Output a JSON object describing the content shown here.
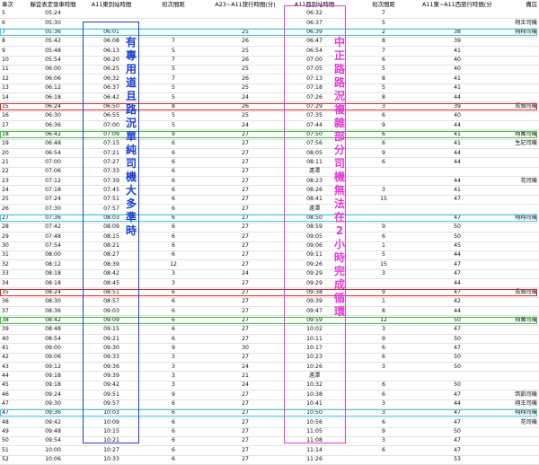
{
  "headers": [
    "車次",
    "靜宜表定發車時間",
    "A11東到站時間",
    "班次間距",
    "A23~A11旅行時間(分)",
    "A11西到站時間",
    "班次間距",
    "A11東~A11西旅行時間(分)",
    "備註"
  ],
  "rows": [
    [
      "5",
      "05:24",
      "",
      "",
      "",
      "06:32",
      "7",
      ""
    ],
    [
      "6",
      "05:30",
      "",
      "",
      "",
      "06:37",
      "5",
      "",
      "翔王司機"
    ],
    [
      "7",
      "05:36",
      "06:01",
      "",
      "25",
      "06:39",
      "2",
      "38",
      "翔翔司機"
    ],
    [
      "8",
      "05:42",
      "06:08",
      "7",
      "26",
      "06:47",
      "8",
      "39",
      ""
    ],
    [
      "9",
      "05:48",
      "06:13",
      "5",
      "25",
      "06:54",
      "7",
      "41",
      ""
    ],
    [
      "10",
      "05:54",
      "06:20",
      "7",
      "26",
      "07:00",
      "6",
      "40",
      ""
    ],
    [
      "11",
      "06:00",
      "06:25",
      "5",
      "25",
      "07:05",
      "5",
      "40",
      ""
    ],
    [
      "12",
      "06:06",
      "06:32",
      "7",
      "26",
      "07:13",
      "8",
      "41",
      ""
    ],
    [
      "13",
      "06:12",
      "06:37",
      "5",
      "25",
      "07:18",
      "5",
      "41",
      ""
    ],
    [
      "14",
      "06:18",
      "06:42",
      "5",
      "24",
      "07:26",
      "8",
      "44",
      ""
    ],
    [
      "15",
      "06:24",
      "06:50",
      "8",
      "26",
      "07:29",
      "3",
      "39",
      "長頭司機"
    ],
    [
      "16",
      "06:30",
      "06:55",
      "5",
      "25",
      "07:35",
      "6",
      "40",
      ""
    ],
    [
      "17",
      "06:36",
      "07:00",
      "5",
      "24",
      "07:44",
      "9",
      "44",
      ""
    ],
    [
      "18",
      "06:42",
      "07:09",
      "9",
      "27",
      "07:50",
      "6",
      "41",
      "翔萬司機"
    ],
    [
      "19",
      "06:48",
      "07:15",
      "6",
      "27",
      "07:56",
      "6",
      "41",
      "生記司機"
    ],
    [
      "20",
      "06:54",
      "07:21",
      "6",
      "27",
      "08:05",
      "9",
      "44",
      ""
    ],
    [
      "21",
      "07:00",
      "07:27",
      "6",
      "27",
      "08:11",
      "6",
      "44",
      ""
    ],
    [
      "22",
      "07:06",
      "07:33",
      "6",
      "27",
      "遠潭",
      "",
      "",
      ""
    ],
    [
      "23",
      "07:12",
      "07:39",
      "6",
      "27",
      "08:23",
      "",
      "44",
      "花司機"
    ],
    [
      "24",
      "07:18",
      "07:45",
      "6",
      "27",
      "08:26",
      "3",
      "41",
      ""
    ],
    [
      "25",
      "07:24",
      "07:51",
      "6",
      "27",
      "08:41",
      "15",
      "47",
      ""
    ],
    [
      "26",
      "07:30",
      "07:57",
      "6",
      "27",
      "遠潭",
      "",
      "",
      ""
    ],
    [
      "27",
      "07:36",
      "08:03",
      "6",
      "27",
      "08:50",
      "",
      "47",
      "翔翔司機"
    ],
    [
      "28",
      "07:42",
      "08:09",
      "6",
      "27",
      "08:59",
      "9",
      "50",
      ""
    ],
    [
      "29",
      "07:48",
      "08:15",
      "6",
      "27",
      "09:05",
      "6",
      "50",
      ""
    ],
    [
      "30",
      "07:54",
      "08:21",
      "6",
      "27",
      "09:06",
      "1",
      "45",
      ""
    ],
    [
      "31",
      "08:00",
      "08:27",
      "6",
      "27",
      "09:11",
      "5",
      "44",
      ""
    ],
    [
      "32",
      "08:12",
      "08:39",
      "12",
      "27",
      "09:26",
      "15",
      "47",
      ""
    ],
    [
      "33",
      "08:18",
      "08:42",
      "3",
      "24",
      "09:29",
      "3",
      "47",
      ""
    ],
    [
      "34",
      "08:18",
      "08:45",
      "3",
      "27",
      "09:29",
      "",
      "44",
      ""
    ],
    [
      "35",
      "08:24",
      "08:51",
      "6",
      "27",
      "09:38",
      "9",
      "47",
      "長頭司機"
    ],
    [
      "36",
      "08:30",
      "08:57",
      "6",
      "27",
      "09:39",
      "1",
      "42",
      ""
    ],
    [
      "37",
      "08:36",
      "09:03",
      "6",
      "27",
      "09:47",
      "8",
      "44",
      ""
    ],
    [
      "38",
      "08:42",
      "09:09",
      "6",
      "27",
      "09:59",
      "12",
      "50",
      "翔萬司機"
    ],
    [
      "39",
      "08:48",
      "09:15",
      "6",
      "27",
      "10:02",
      "3",
      "47",
      ""
    ],
    [
      "40",
      "08:54",
      "09:21",
      "6",
      "27",
      "10:11",
      "9",
      "50",
      ""
    ],
    [
      "41",
      "09:00",
      "09:30",
      "9",
      "30",
      "10:17",
      "6",
      "47",
      ""
    ],
    [
      "42",
      "09:06",
      "09:33",
      "3",
      "27",
      "10:23",
      "6",
      "50",
      ""
    ],
    [
      "43",
      "09:12",
      "09:36",
      "3",
      "24",
      "10:26",
      "3",
      "50",
      ""
    ],
    [
      "44",
      "09:18",
      "09:39",
      "3",
      "21",
      "遠潭",
      "",
      "",
      ""
    ],
    [
      "45",
      "09:18",
      "09:42",
      "3",
      "24",
      "10:32",
      "6",
      "50",
      ""
    ],
    [
      "46",
      "09:24",
      "09:51",
      "9",
      "27",
      "10:38",
      "6",
      "47",
      "筑凱司機"
    ],
    [
      "47",
      "09:30",
      "09:57",
      "6",
      "27",
      "10:41",
      "3",
      "44",
      "翔王司機"
    ],
    [
      "47",
      "09:36",
      "10:03",
      "6",
      "27",
      "10:50",
      "3",
      "47",
      "翔翔司機"
    ],
    [
      "48",
      "09:42",
      "10:09",
      "6",
      "27",
      "10:56",
      "6",
      "47",
      "花司機"
    ],
    [
      "49",
      "09:48",
      "10:15",
      "6",
      "27",
      "11:05",
      "9",
      "50",
      ""
    ],
    [
      "50",
      "09:54",
      "10:21",
      "6",
      "27",
      "11:08",
      "3",
      "47",
      ""
    ],
    [
      "51",
      "10:00",
      "10:27",
      "6",
      "27",
      "11:14",
      "6",
      "47",
      ""
    ],
    [
      "52",
      "10:06",
      "10:33",
      "6",
      "27",
      "11:26",
      "",
      "53",
      ""
    ]
  ],
  "annotations": {
    "left_note": "有專用道且路況單純司機大多準時",
    "right_note": "中正路路況複雜部分司機無法在2小時完成循環"
  },
  "colors": {
    "highlight_cyan": "#38d0e8",
    "highlight_red": "#e32828",
    "highlight_green": "#33cc33",
    "box_blue": "#1a3fd6",
    "box_magenta": "#e23bd8",
    "text_blue": "#1a3fd6",
    "text_magenta": "#e23bd8"
  }
}
